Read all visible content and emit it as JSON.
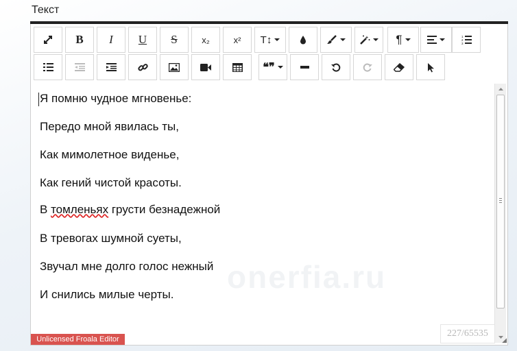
{
  "field_label": "Текст",
  "toolbar": {
    "row1": [
      {
        "name": "fullscreen-button",
        "icon": "expand-icon"
      },
      {
        "name": "bold-button",
        "icon": "bold-icon",
        "text": "B"
      },
      {
        "name": "italic-button",
        "icon": "italic-icon",
        "text": "I"
      },
      {
        "name": "underline-button",
        "icon": "underline-icon",
        "text": "U"
      },
      {
        "name": "strikethrough-button",
        "icon": "strikethrough-icon",
        "text": "S"
      },
      {
        "name": "subscript-button",
        "icon": "subscript-icon",
        "text": "x₂"
      },
      {
        "name": "superscript-button",
        "icon": "superscript-icon",
        "text": "x²"
      },
      {
        "name": "font-size-button",
        "icon": "font-size-icon",
        "text": "T↕"
      },
      {
        "name": "color-button",
        "icon": "droplet-icon"
      },
      {
        "name": "paragraph-style-button",
        "icon": "paintbrush-icon"
      },
      {
        "name": "inline-style-button",
        "icon": "magic-icon"
      },
      {
        "name": "paragraph-format-button",
        "icon": "pilcrow-icon",
        "text": "¶"
      },
      {
        "name": "align-button",
        "icon": "align-left-icon"
      },
      {
        "name": "ordered-list-button",
        "icon": "ordered-list-icon"
      }
    ],
    "row2": [
      {
        "name": "unordered-list-button",
        "icon": "unordered-list-icon"
      },
      {
        "name": "outdent-button",
        "icon": "outdent-icon"
      },
      {
        "name": "indent-button",
        "icon": "indent-icon"
      },
      {
        "name": "insert-link-button",
        "icon": "link-icon"
      },
      {
        "name": "insert-image-button",
        "icon": "image-icon"
      },
      {
        "name": "insert-video-button",
        "icon": "video-icon"
      },
      {
        "name": "insert-table-button",
        "icon": "table-icon"
      },
      {
        "name": "quote-button",
        "icon": "quote-icon",
        "text": "❝❞"
      },
      {
        "name": "horizontal-line-button",
        "icon": "minus-icon"
      },
      {
        "name": "undo-button",
        "icon": "undo-icon"
      },
      {
        "name": "redo-button",
        "icon": "redo-icon"
      },
      {
        "name": "clear-formatting-button",
        "icon": "eraser-icon"
      },
      {
        "name": "select-all-button",
        "icon": "cursor-icon"
      }
    ]
  },
  "content": {
    "lines": [
      "Я помню чудное мгновенье:",
      "Передо мной явилась ты,",
      "Как мимолетное виденье,",
      "Как гений чистой красоты.",
      "в томленьях грусти безнадежной",
      "В тревогах шумной суеты,",
      "Звучал мне долго голос нежный",
      "И снились милые черты."
    ],
    "line5_prefix": "В ",
    "line5_misspelled": "томленьях",
    "line5_suffix": " грусти безнадежной",
    "watermark": "onerfia.ru"
  },
  "counter": "227/65535",
  "license_label": "Unlicensed Froala Editor",
  "colors": {
    "license_bg": "#d9534f",
    "toolbar_top_border": "#222222"
  }
}
